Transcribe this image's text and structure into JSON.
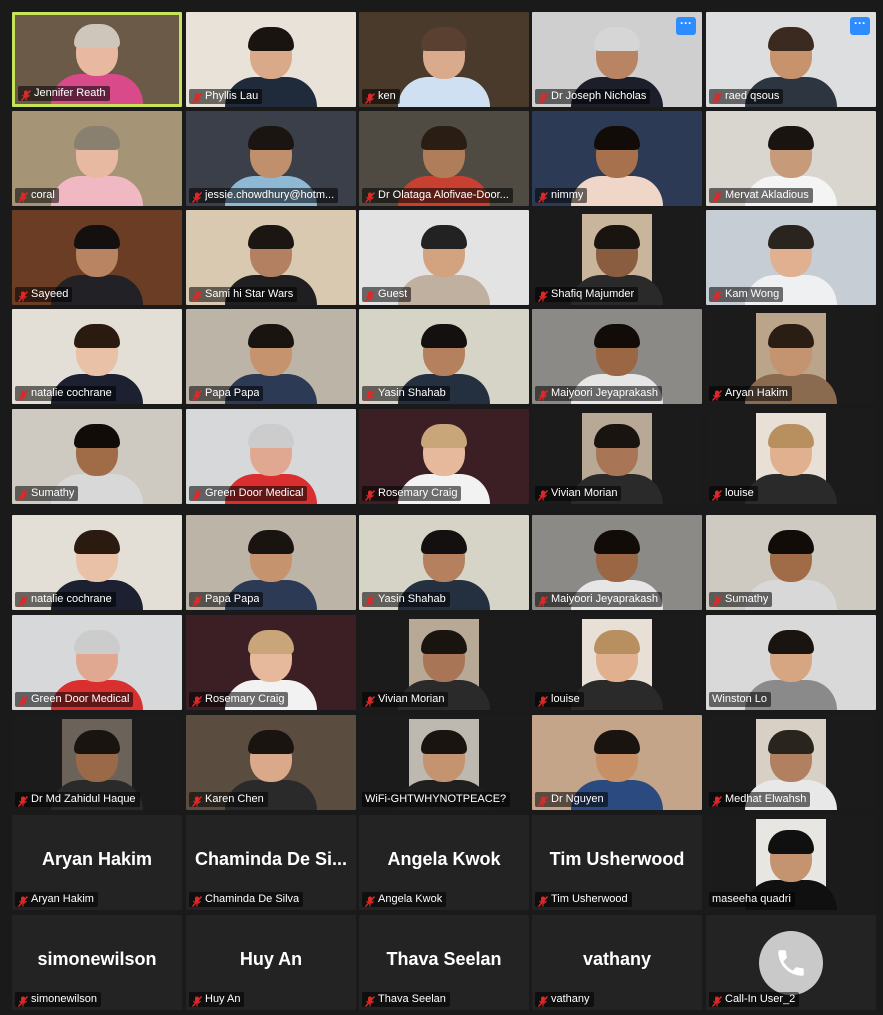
{
  "app": "Zoom gallery view",
  "participants": [
    {
      "name": "Jennifer Reath",
      "active": true,
      "bg": "#6b5a48",
      "skin": "#e8b9a0",
      "shirt": "#d84a8a",
      "hair": "#cfc6bb"
    },
    {
      "name": "Phyllis Lau",
      "bg": "#e8e2d8",
      "skin": "#d9a98a",
      "shirt": "#1f2a3a",
      "hair": "#1a1410"
    },
    {
      "name": "ken",
      "bg": "#4a3a2c",
      "skin": "#d9aa8c",
      "shirt": "#cfe0f2",
      "hair": "#5a4030"
    },
    {
      "name": "Dr Joseph Nicholas",
      "more": true,
      "bg": "#cfcfcf",
      "skin": "#b98463",
      "shirt": "#1c1f2a",
      "hair": "#d6d6d6"
    },
    {
      "name": "raed qsous",
      "more": true,
      "bg": "#dcdedf",
      "skin": "#c7936d",
      "shirt": "#2d3640",
      "hair": "#3a2a20"
    },
    {
      "name": "coral",
      "bg": "#a59476",
      "skin": "#e7b9a0",
      "shirt": "#f0b8c2",
      "hair": "#8a8070"
    },
    {
      "name": "jessie.chowdhury@hotm...",
      "bg": "#3a3f4a",
      "skin": "#c08f6c",
      "shirt": "#8fb8d4",
      "hair": "#1b1512"
    },
    {
      "name": "Dr Olataga Alofivae-Door...",
      "bg": "#4f4a42",
      "skin": "#b07d5a",
      "shirt": "#c84030",
      "hair": "#2a1d14"
    },
    {
      "name": "nimmy",
      "bg": "#2d3a55",
      "skin": "#a8714d",
      "shirt": "#f0d6c8",
      "hair": "#120c08"
    },
    {
      "name": "Mervat Akladious",
      "bg": "#d9d6cf",
      "skin": "#c79a7a",
      "shirt": "#f4f4f4",
      "hair": "#1a1410"
    },
    {
      "name": "Sayeed",
      "bg": "#6b3d24",
      "skin": "#b98461",
      "shirt": "#222226",
      "hair": "#141010"
    },
    {
      "name": "Sami hi Star Wars",
      "bg": "#d8c9b0",
      "skin": "#b38161",
      "shirt": "#1f1f22",
      "hair": "#1c1612"
    },
    {
      "name": "Guest",
      "bg": "#e3e3e3",
      "skin": "#d3a27e",
      "shirt": "#c0b0a0",
      "hair": "#222"
    },
    {
      "name": "Shafiq Majumder",
      "bg": "#1b1b1b",
      "skin": "#8a5d40",
      "shirt": "#2a2a2a",
      "hair": "#1a1410",
      "panel": "#c9b59c"
    },
    {
      "name": "Kam Wong",
      "bg": "#c7cdd4",
      "skin": "#e0b090",
      "shirt": "#eef0f2",
      "hair": "#2a241f"
    },
    {
      "name": "natalie cochrane",
      "bg": "#e4dfd6",
      "skin": "#e8c1a6",
      "shirt": "#1c2030",
      "hair": "#2a1a10"
    },
    {
      "name": "Papa Papa",
      "bg": "#bdb4a8",
      "skin": "#c5946f",
      "shirt": "#2d3a55",
      "hair": "#1a1410"
    },
    {
      "name": "Yasin Shahab",
      "bg": "#d6d3c7",
      "skin": "#b5805d",
      "shirt": "#243040",
      "hair": "#141010"
    },
    {
      "name": "Maiyoori Jeyaprakash",
      "bg": "#8c8a86",
      "skin": "#9a6644",
      "shirt": "#e6e6e6",
      "hair": "#120c08"
    },
    {
      "name": "Aryan Hakim",
      "bg": "#1b1b1b",
      "skin": "#c49370",
      "shirt": "#8a6b50",
      "hair": "#2a1d14",
      "panel": "#bba58a"
    },
    {
      "name": "Sumathy",
      "bg": "#cfcac1",
      "skin": "#a06b47",
      "shirt": "#d8d8d8",
      "hair": "#120c08"
    },
    {
      "name": "Green Door Medical",
      "bg": "#d6d8d9",
      "skin": "#e0a890",
      "shirt": "#d92f2f",
      "hair": "#cccccc"
    },
    {
      "name": "Rosemary Craig",
      "bg": "#3b1f24",
      "skin": "#e6b89c",
      "shirt": "#f2f2f2",
      "hair": "#c9a57a"
    },
    {
      "name": "Vivian Morian",
      "bg": "#1b1b1b",
      "skin": "#a87556",
      "shirt": "#2a2a2a",
      "hair": "#1a1410",
      "panel": "#b8a896"
    },
    {
      "name": "louise",
      "bg": "#1b1b1b",
      "skin": "#e1b08e",
      "shirt": "#2a2a2a",
      "hair": "#b89060",
      "panel": "#e8e0d6"
    },
    {
      "name": "natalie cochrane",
      "bg": "#e4dfd6",
      "skin": "#e8c1a6",
      "shirt": "#1c2030",
      "hair": "#2a1a10"
    },
    {
      "name": "Papa Papa",
      "bg": "#bdb4a8",
      "skin": "#c5946f",
      "shirt": "#2d3a55",
      "hair": "#1a1410"
    },
    {
      "name": "Yasin Shahab",
      "bg": "#d6d3c7",
      "skin": "#b5805d",
      "shirt": "#243040",
      "hair": "#141010"
    },
    {
      "name": "Maiyoori Jeyaprakash",
      "bg": "#8c8a86",
      "skin": "#9a6644",
      "shirt": "#e6e6e6",
      "hair": "#120c08"
    },
    {
      "name": "Sumathy",
      "bg": "#cfcac1",
      "skin": "#a06b47",
      "shirt": "#d8d8d8",
      "hair": "#120c08"
    },
    {
      "name": "Green Door Medical",
      "bg": "#d6d8d9",
      "skin": "#e0a890",
      "shirt": "#d92f2f",
      "hair": "#cccccc"
    },
    {
      "name": "Rosemary Craig",
      "bg": "#3b1f24",
      "skin": "#e6b89c",
      "shirt": "#f2f2f2",
      "hair": "#c9a57a"
    },
    {
      "name": "Vivian Morian",
      "bg": "#1b1b1b",
      "skin": "#a87556",
      "shirt": "#2a2a2a",
      "hair": "#1a1410",
      "panel": "#b8a896"
    },
    {
      "name": "louise",
      "bg": "#1b1b1b",
      "skin": "#e1b08e",
      "shirt": "#2a2a2a",
      "hair": "#b89060",
      "panel": "#e8e0d6"
    },
    {
      "name": "Winston Lo",
      "muted": false,
      "bg": "#d9d9d9",
      "skin": "#d6a682",
      "shirt": "#8a8a8a",
      "hair": "#1a1410"
    },
    {
      "name": "Dr Md Zahidul Haque",
      "bg": "#1b1b1b",
      "skin": "#9a6a48",
      "shirt": "#2a2a2a",
      "hair": "#1a1410",
      "panel": "#6b625a"
    },
    {
      "name": "Karen Chen",
      "bg": "#5a4d40",
      "skin": "#d9a98a",
      "shirt": "#2a2a2a",
      "hair": "#1a1410"
    },
    {
      "name": "WiFi-GHTWHYNOTPEACE?",
      "muted": false,
      "bg": "#1b1b1b",
      "skin": "#c49370",
      "shirt": "#1f1f1f",
      "hair": "#1a1410",
      "panel": "#bdb8b0"
    },
    {
      "name": "Dr Nguyen",
      "bg": "#c4a58a",
      "skin": "#c78f65",
      "shirt": "#2a4a80",
      "hair": "#1a1410"
    },
    {
      "name": "Medhat Elwahsh",
      "bg": "#1b1b1b",
      "skin": "#b08060",
      "shirt": "#e8e8e8",
      "hair": "#2a241f",
      "panel": "#d8d0c4"
    },
    {
      "name": "Aryan Hakim",
      "display": "Aryan Hakim",
      "novideo": true
    },
    {
      "name": "Chaminda De Silva",
      "display": "Chaminda De Si...",
      "novideo": true
    },
    {
      "name": "Angela Kwok",
      "display": "Angela Kwok",
      "novideo": true
    },
    {
      "name": "Tim Usherwood",
      "display": "Tim Usherwood",
      "novideo": true
    },
    {
      "name": "maseeha quadri",
      "muted": false,
      "bg": "#1b1b1b",
      "skin": "#c49370",
      "shirt": "#101010",
      "hair": "#101010",
      "panel": "#e8e6e2"
    },
    {
      "name": "simonewilson",
      "display": "simonewilson",
      "novideo": true
    },
    {
      "name": "Huy An",
      "display": "Huy An",
      "novideo": true
    },
    {
      "name": "Thava Seelan",
      "display": "Thava Seelan",
      "novideo": true
    },
    {
      "name": "vathany",
      "display": "vathany",
      "novideo": true
    },
    {
      "name": "Call-In User_2",
      "phone": true,
      "novideo": true
    }
  ],
  "colors": {
    "active_border": "#c6e35a",
    "mute_red": "#e02828",
    "more_blue": "#2d8cff",
    "tile_dark": "#232323"
  },
  "more_glyph": "···"
}
